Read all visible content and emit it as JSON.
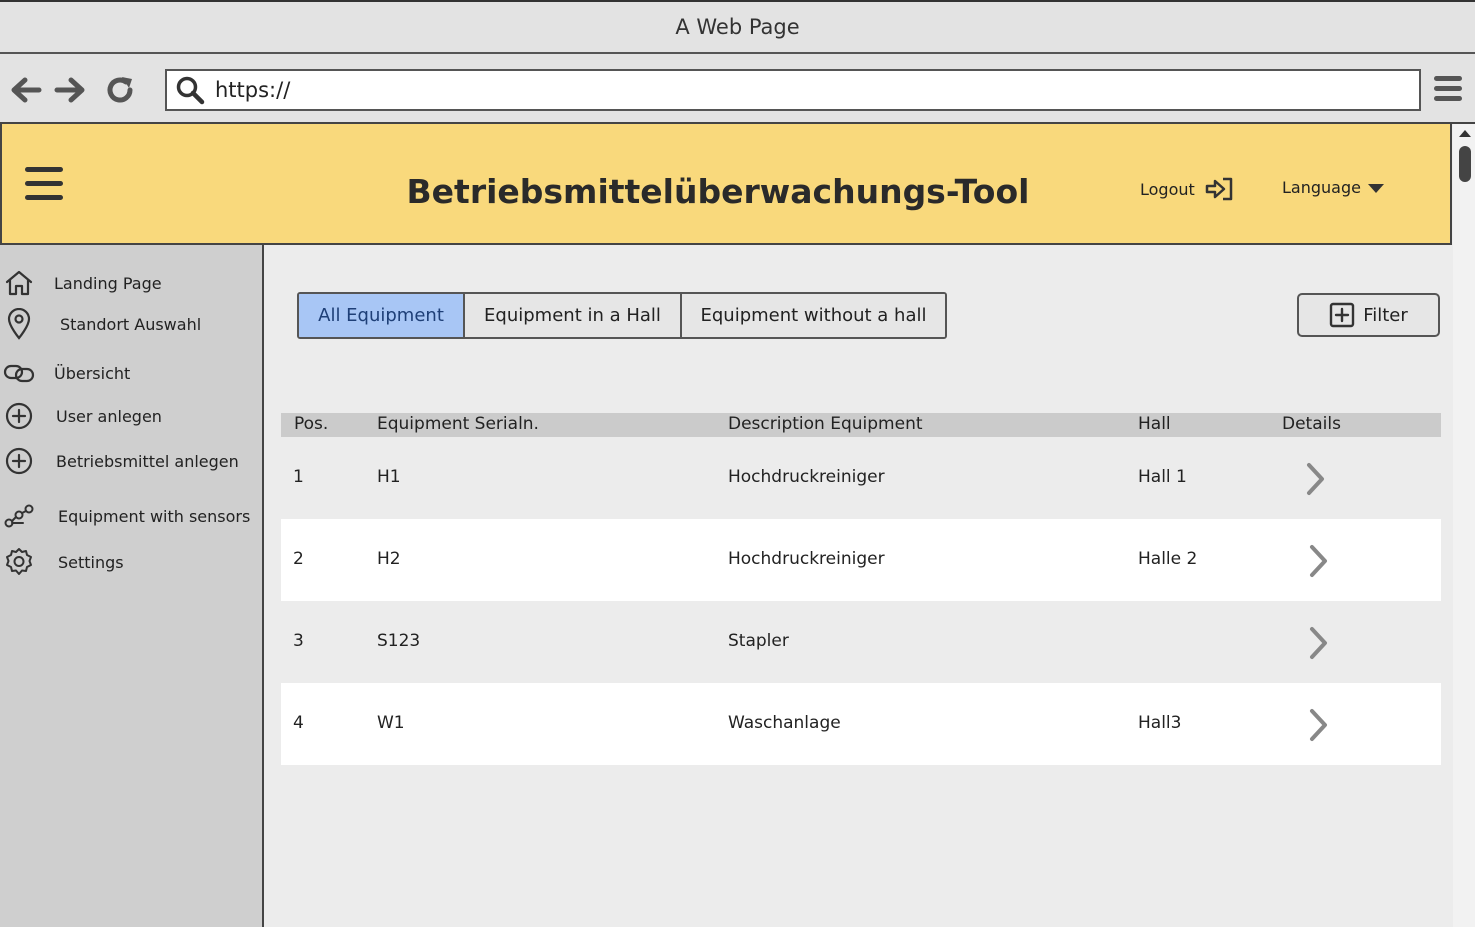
{
  "browser": {
    "window_title": "A Web Page",
    "url": "https://"
  },
  "header": {
    "title": "Betriebsmittelüberwachungs-Tool",
    "logout_label": "Logout",
    "language_label": "Language"
  },
  "sidebar": {
    "items": [
      {
        "label": "Landing Page",
        "icon": "home-icon"
      },
      {
        "label": "Standort Auswahl",
        "icon": "location-pin-icon"
      },
      {
        "label": "Übersicht",
        "icon": "link-icon"
      },
      {
        "label": "User anlegen",
        "icon": "plus-circle-icon"
      },
      {
        "label": "Betriebsmittel anlegen",
        "icon": "plus-circle-icon"
      },
      {
        "label": "Equipment with sensors",
        "icon": "sensor-network-icon"
      },
      {
        "label": "Settings",
        "icon": "gear-icon"
      }
    ]
  },
  "tabs": [
    {
      "label": "All Equipment",
      "active": true
    },
    {
      "label": "Equipment in a Hall",
      "active": false
    },
    {
      "label": "Equipment without a hall",
      "active": false
    }
  ],
  "filter": {
    "label": "Filter"
  },
  "table": {
    "headers": [
      "Pos.",
      "Equipment Serialn.",
      "Description Equipment",
      "Hall",
      "Details"
    ],
    "rows": [
      {
        "pos": "1",
        "serial": "H1",
        "description": "Hochdruckreiniger",
        "hall": "Hall 1"
      },
      {
        "pos": "2",
        "serial": "H2",
        "description": "Hochdruckreiniger",
        "hall": "Halle 2"
      },
      {
        "pos": "3",
        "serial": "S123",
        "description": "Stapler",
        "hall": ""
      },
      {
        "pos": "4",
        "serial": "W1",
        "description": "Waschanlage",
        "hall": "Hall3"
      }
    ]
  },
  "colors": {
    "header_bg": "#f9d97c",
    "active_tab": "#a8c6f5",
    "sidebar_bg": "#cfcfcf"
  }
}
